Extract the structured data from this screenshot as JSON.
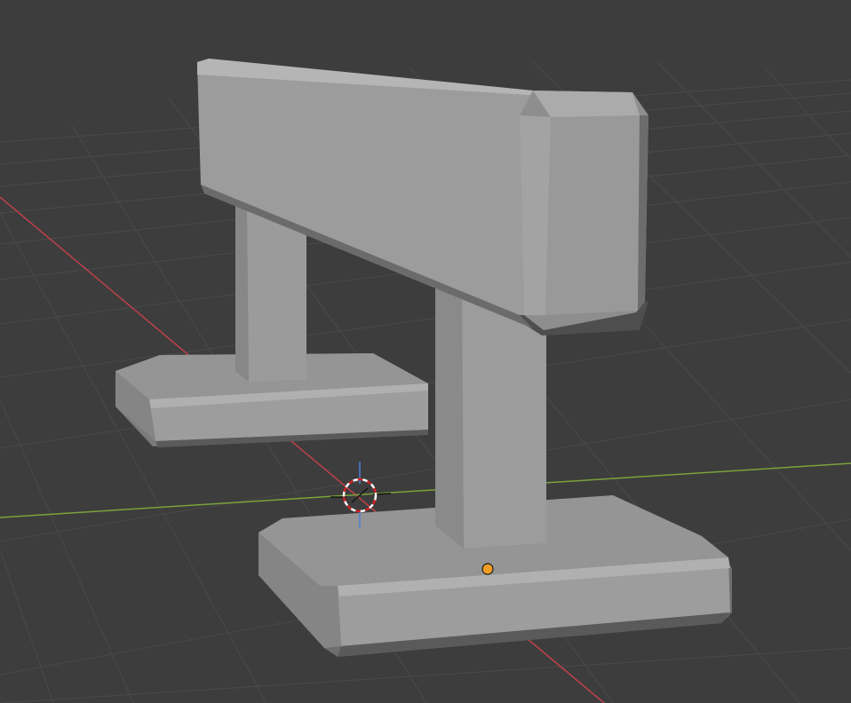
{
  "viewport": {
    "background": "#3d3d3d",
    "grid_color": "#4a4a4a",
    "x_axis_color": "#c0404a",
    "y_axis_color": "#7aa33a",
    "z_axis_color": "#4b7fd6"
  },
  "scene": {
    "object_name": "barrier",
    "object_color": "#9a9a9a",
    "cursor_icon": "3d-cursor-icon",
    "origin_icon": "object-origin-icon",
    "origin_color": "#f29d25"
  }
}
